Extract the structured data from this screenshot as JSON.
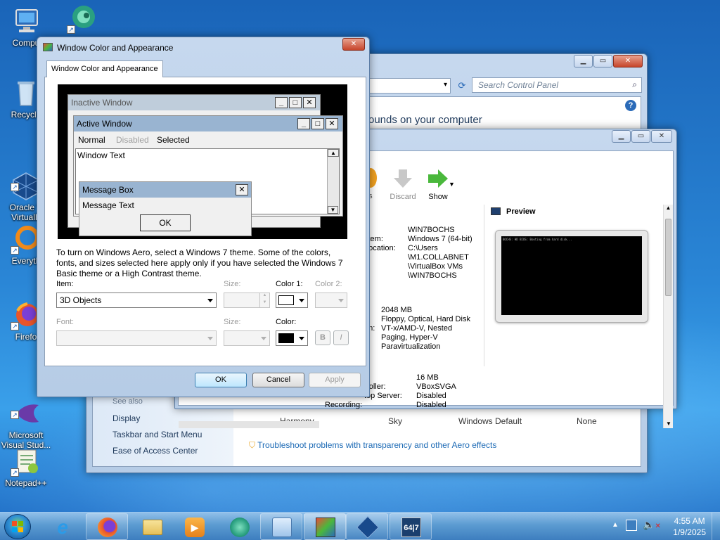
{
  "desktop": {
    "icons": [
      {
        "label": "Compu",
        "name": "computer"
      },
      {
        "label": "Recycle",
        "name": "recycle-bin"
      },
      {
        "label": "Oracle V\nVirtualB",
        "name": "virtualbox"
      },
      {
        "label": "Everyth",
        "name": "everything"
      },
      {
        "label": "Firefo",
        "name": "firefox"
      },
      {
        "label": "Microsoft\nVisual Stud...",
        "name": "visual-studio"
      },
      {
        "label": "Notepad++",
        "name": "notepad-plus-plus"
      }
    ]
  },
  "control_panel": {
    "search_placeholder": "Search Control Panel",
    "heading_partial": "ounds on your computer",
    "see_also": "See also",
    "links": [
      "Display",
      "Taskbar and Start Menu",
      "Ease of Access Center"
    ],
    "themes": [
      "Harmony",
      "Sky",
      "Windows Default",
      "None"
    ],
    "troubleshoot": "Troubleshoot problems with transparency and other Aero effects"
  },
  "virtualbox": {
    "toolbar": {
      "settings": "gs",
      "discard": "Discard",
      "show": "Show"
    },
    "general": {
      "header": "l",
      "rows": [
        {
          "k": "",
          "v": "WIN7BOCHS"
        },
        {
          "k": "stem:",
          "v": "Windows 7 (64-bit)"
        },
        {
          "k": "Location:",
          "v": "C:\\Users\n\\M1.COLLABNET\n\\VirtualBox VMs\n\\WIN7BOCHS"
        }
      ]
    },
    "system": {
      "header": "n",
      "rows": [
        {
          "k": "y:",
          "v": "2048 MB"
        },
        {
          "k": ":",
          "v": "Floppy, Optical, Hard Disk"
        },
        {
          "k": "on:",
          "v": "VT-x/AMD-V, Nested\nPaging, Hyper-V\nParavirtualization"
        }
      ]
    },
    "display": {
      "rows": [
        {
          "k": "y:",
          "v": "16 MB"
        },
        {
          "k": "troller:",
          "v": "VBoxSVGA"
        },
        {
          "k": "top Server:",
          "v": "Disabled"
        },
        {
          "k": "Recording:",
          "v": "Disabled"
        }
      ]
    },
    "preview_title": "Preview",
    "preview_text": "BOCHS: HD BIOS: Booting from hard disk..."
  },
  "dialog": {
    "title": "Window Color and Appearance",
    "tab": "Window Color and Appearance",
    "preview": {
      "inactive_title": "Inactive Window",
      "active_title": "Active Window",
      "menu_normal": "Normal",
      "menu_disabled": "Disabled",
      "menu_selected": "Selected",
      "window_text": "Window Text",
      "msgbox_title": "Message Box",
      "msgbox_text": "Message Text",
      "msgbox_ok": "OK"
    },
    "description": "To turn on Windows Aero, select a Windows 7 theme.  Some of the colors, fonts, and sizes selected here apply only if you have selected the Windows 7 Basic theme or a High Contrast theme.",
    "item_label": "Item:",
    "item_value": "3D Objects",
    "size_label": "Size:",
    "color1_label": "Color 1:",
    "color2_label": "Color 2:",
    "font_label": "Font:",
    "font_size_label": "Size:",
    "font_color_label": "Color:",
    "bold_label": "B",
    "italic_label": "I",
    "color1_swatch": "#ffffff",
    "font_color_swatch": "#000000",
    "ok": "OK",
    "cancel": "Cancel",
    "apply": "Apply"
  },
  "taskbar": {
    "apps": [
      "start",
      "internet-explorer",
      "firefox",
      "file-explorer",
      "media-player",
      "app-green",
      "control-panel",
      "window-color",
      "virtualbox",
      "win7-app"
    ],
    "time": "4:55 AM",
    "date": "1/9/2025"
  }
}
